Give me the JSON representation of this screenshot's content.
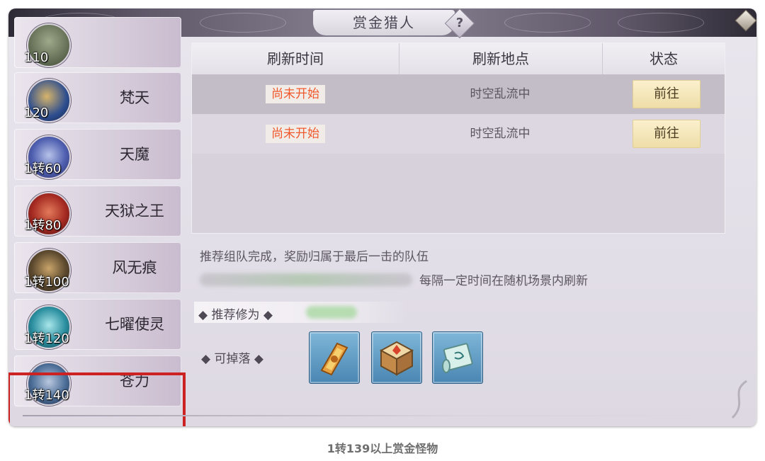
{
  "window": {
    "title": "赏金猎人",
    "help_symbol": "?"
  },
  "bosses": [
    {
      "name": "",
      "level": "110"
    },
    {
      "name": "梵天",
      "level": "120"
    },
    {
      "name": "天魔",
      "level": "1转60"
    },
    {
      "name": "天狱之王",
      "level": "1转80"
    },
    {
      "name": "风无痕",
      "level": "1转100"
    },
    {
      "name": "七曜使灵",
      "level": "1转120"
    },
    {
      "name": "苍力",
      "level": "1转140",
      "selected": true
    }
  ],
  "table": {
    "headers": [
      "刷新时间",
      "刷新地点",
      "状态"
    ],
    "rows": [
      {
        "time": "尚未开始",
        "place": "时空乱流中",
        "action": "前往"
      },
      {
        "time": "尚未开始",
        "place": "时空乱流中",
        "action": "前往"
      }
    ]
  },
  "info": {
    "line1": "推荐组队完成，奖励归属于最后一击的队伍",
    "line2": "每隔一定时间在随机场景内刷新"
  },
  "recommend_label": "◆ 推荐修为 ◆",
  "drops_label": "◆  可掉落  ◆",
  "drops": [
    {
      "icon": "golden-token-icon"
    },
    {
      "icon": "treasure-cube-icon"
    },
    {
      "icon": "scroll-icon"
    }
  ],
  "caption": "1转139以上赏金怪物",
  "colors": {
    "status_text": "#f0592c",
    "highlight_frame": "#cc2222",
    "button_bg": "#f4e6b8"
  }
}
